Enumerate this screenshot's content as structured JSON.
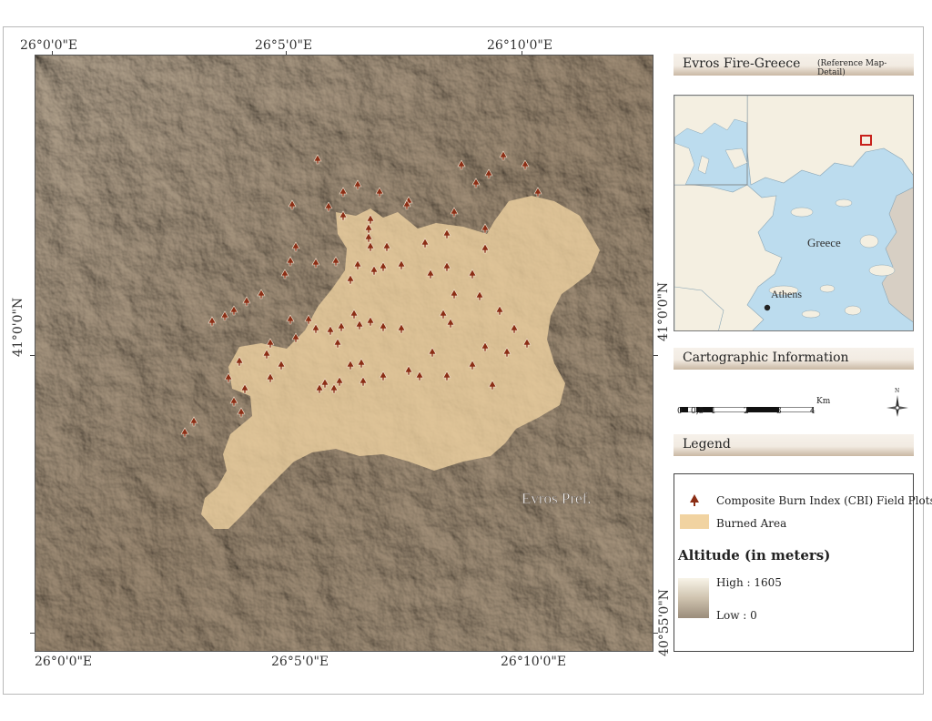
{
  "map": {
    "top_labels": [
      "26°0'0\"E",
      "26°5'0\"E",
      "26°10'0\"E"
    ],
    "bottom_labels": [
      "26°0'0\"E",
      "26°5'0\"E",
      "26°10'0\"E"
    ],
    "left_label": "41°0'0\"N",
    "right_labels": [
      "41°0'0\"N",
      "40°55'0\"N"
    ],
    "region_label": "Evros Pref.",
    "colors": {
      "burned": "#e6c99a",
      "plot": "#8b2e15",
      "relief_mid": "#8a7c6c"
    }
  },
  "panel": {
    "title": "Evros Fire-Greece",
    "subtitle": "(Reference Map-Detail)",
    "inset": {
      "country_label": "Greece",
      "city_label": "Athens",
      "sea_color": "#bcdcee",
      "land_color": "#f4efe1"
    },
    "cartographic_title": "Cartographic Information",
    "scale_labels": [
      "0",
      "0,5",
      "1",
      "2",
      "3",
      "4"
    ],
    "scale_unit": "Km",
    "north_label": "N",
    "legend_title": "Legend",
    "legend": {
      "plots_label": "Composite Burn Index (CBI) Field Plots",
      "burned_label": "Burned Area",
      "altitude_title": "Altitude (in meters)",
      "high_label": "High : 1605",
      "low_label": "Low : 0"
    }
  }
}
